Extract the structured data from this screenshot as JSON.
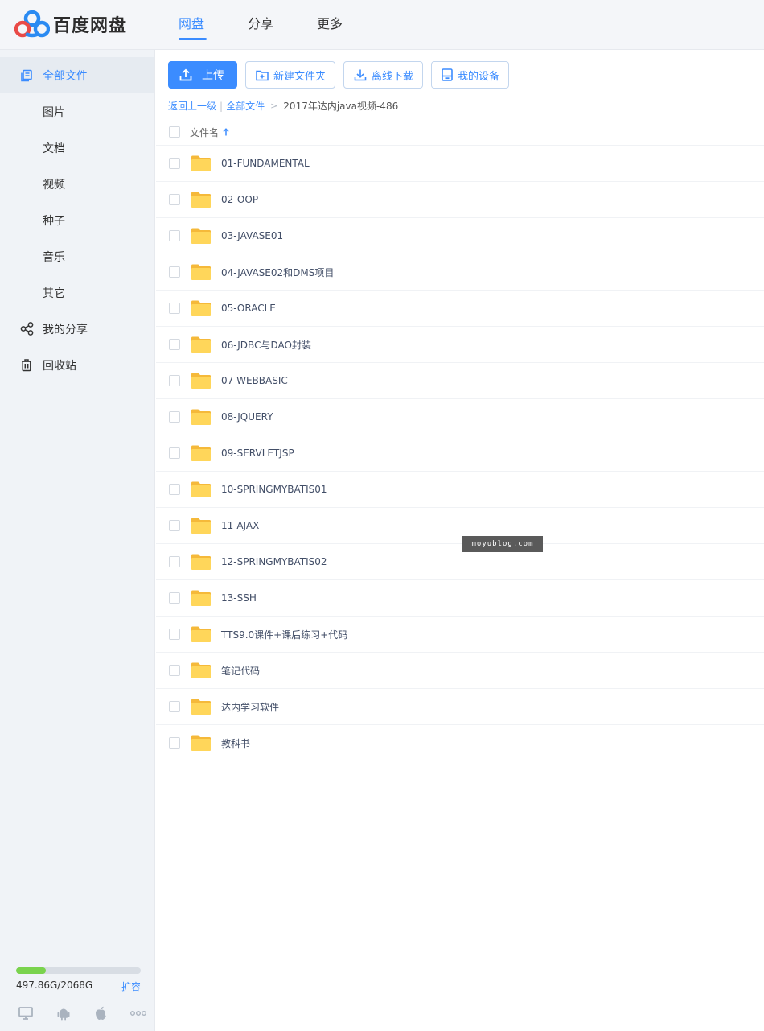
{
  "header": {
    "logo_text": "百度网盘",
    "nav": [
      {
        "label": "网盘",
        "active": true
      },
      {
        "label": "分享",
        "active": false
      },
      {
        "label": "更多",
        "active": false
      }
    ]
  },
  "sidebar": {
    "items": [
      {
        "label": "全部文件",
        "icon": "all-files-icon",
        "active": true
      },
      {
        "label": "图片"
      },
      {
        "label": "文档"
      },
      {
        "label": "视频"
      },
      {
        "label": "种子"
      },
      {
        "label": "音乐"
      },
      {
        "label": "其它"
      },
      {
        "label": "我的分享",
        "icon": "share-icon"
      },
      {
        "label": "回收站",
        "icon": "trash-icon"
      }
    ],
    "quota": {
      "text": "497.86G/2068G",
      "used_fraction": 0.24,
      "expand_label": "扩容"
    },
    "devices": [
      "desktop-icon",
      "android-icon",
      "apple-icon",
      "more-icon"
    ]
  },
  "toolbar": {
    "upload": "上传",
    "new_folder": "新建文件夹",
    "offline_download": "离线下载",
    "my_devices": "我的设备"
  },
  "breadcrumb": {
    "back": "返回上一级",
    "all_files": "全部文件",
    "current": "2017年达内java视频-486"
  },
  "list": {
    "column_name": "文件名",
    "files": [
      "01-FUNDAMENTAL",
      "02-OOP",
      "03-JAVASE01",
      "04-JAVASE02和DMS项目",
      "05-ORACLE",
      "06-JDBC与DAO封装",
      "07-WEBBASIC",
      "08-JQUERY",
      "09-SERVLETJSP",
      "10-SPRINGMYBATIS01",
      "11-AJAX",
      "12-SPRINGMYBATIS02",
      "13-SSH",
      "TTS9.0课件+课后练习+代码",
      "笔记代码",
      "达内学习软件",
      "教科书"
    ]
  },
  "watermark": "moyublog.com",
  "colors": {
    "accent": "#3b8cff",
    "folder": "#ffd65a",
    "quota": "#7ad34d"
  }
}
